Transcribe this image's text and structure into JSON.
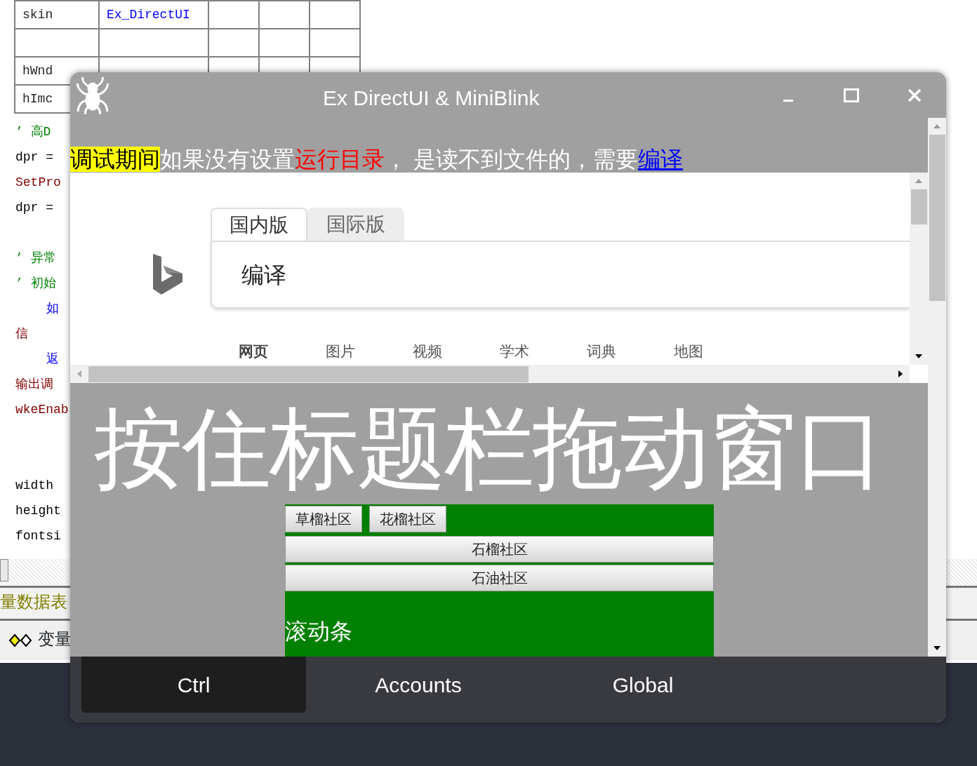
{
  "ide": {
    "table_rows": [
      {
        "kind": "field",
        "label": "skin",
        "value": "Ex_DirectUI"
      },
      {
        "kind": "blank"
      },
      {
        "kind": "field",
        "label": "hWnd"
      },
      {
        "kind": "field",
        "label": "hImc"
      }
    ],
    "code_lines": [
      {
        "kind": "comment",
        "text": "’ 高D"
      },
      {
        "kind": "code",
        "text": "dpr ="
      },
      {
        "kind": "call",
        "text": "SetPro"
      },
      {
        "kind": "code",
        "text": "dpr ="
      },
      {
        "kind": "blank"
      },
      {
        "kind": "comment",
        "text": "’ 异常"
      },
      {
        "kind": "comment",
        "text": "’ 初始"
      },
      {
        "kind": "keyword",
        "text": "如"
      },
      {
        "kind": "call",
        "text": "信"
      },
      {
        "kind": "keyword",
        "text": "返"
      },
      {
        "kind": "call",
        "text": "输出调"
      },
      {
        "kind": "call",
        "text": "wkeEnab"
      },
      {
        "kind": "blank"
      },
      {
        "kind": "blank"
      },
      {
        "kind": "code",
        "text": "width"
      },
      {
        "kind": "code",
        "text": "height"
      },
      {
        "kind": "code",
        "text": "fontsi"
      }
    ],
    "file_tab": "量数据表",
    "panel_tab": "变量"
  },
  "window": {
    "title": "Ex DirectUI & MiniBlink",
    "notice": [
      {
        "kind": "highlight",
        "text": "调试期间"
      },
      {
        "kind": "plain",
        "text": "如果没有设置"
      },
      {
        "kind": "warning",
        "text": "运行目录"
      },
      {
        "kind": "plain",
        "text": "， 是读不到文件的，需要"
      },
      {
        "kind": "link",
        "text": "编译"
      }
    ],
    "browser": {
      "tabs": [
        {
          "label": "国内版",
          "selected": true
        },
        {
          "label": "国际版",
          "selected": false
        }
      ],
      "search_value": "编译",
      "nav": [
        {
          "label": "网页",
          "selected": true
        },
        {
          "label": "图片",
          "selected": false
        },
        {
          "label": "视频",
          "selected": false
        },
        {
          "label": "学术",
          "selected": false
        },
        {
          "label": "词典",
          "selected": false
        },
        {
          "label": "地图",
          "selected": false
        }
      ]
    },
    "banner": "按住标题栏拖动窗口",
    "community": {
      "tabs": [
        "草榴社区",
        "花榴社区"
      ],
      "buttons": [
        "石榴社区",
        "石油社区"
      ],
      "caption": "滚动条"
    },
    "nav_tabs": [
      {
        "label": "Ctrl",
        "selected": true
      },
      {
        "label": "Accounts",
        "selected": false
      },
      {
        "label": "Global",
        "selected": false
      }
    ]
  }
}
